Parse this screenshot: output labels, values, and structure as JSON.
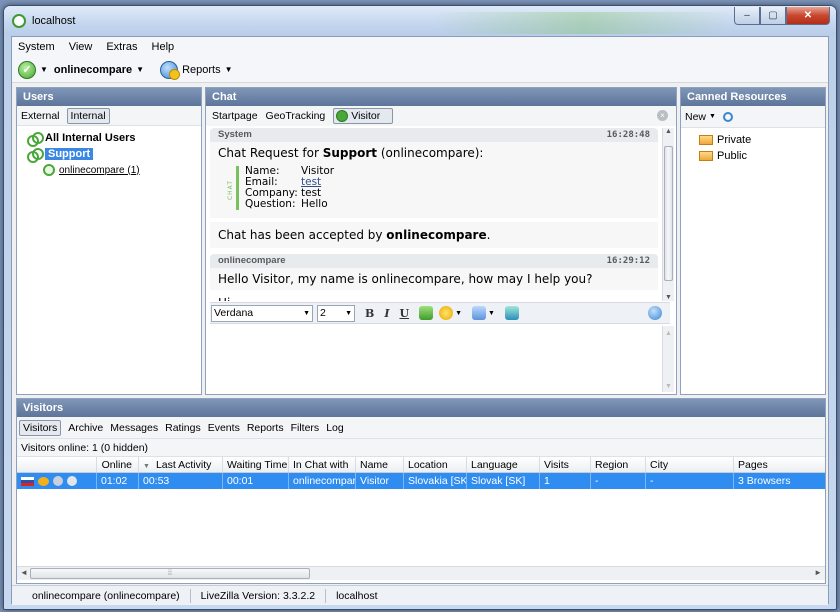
{
  "window": {
    "title": "localhost",
    "buttons": [
      "–",
      "▢",
      "✕"
    ]
  },
  "menu": {
    "items": [
      "System",
      "View",
      "Extras",
      "Help"
    ]
  },
  "toolbar": {
    "user_label": "onlinecompare",
    "reports_label": "Reports"
  },
  "users_panel": {
    "title": "Users",
    "tabs": [
      "External",
      "Internal"
    ],
    "selected_tab": "Internal",
    "tree": {
      "all": "All Internal Users",
      "group": "Support",
      "member": "onlinecompare (1)"
    }
  },
  "chat_panel": {
    "title": "Chat",
    "tabs": [
      "Startpage",
      "GeoTracking",
      "Visitor"
    ],
    "selected_tab": "Visitor",
    "messages": [
      {
        "sender": "System",
        "time": "16:28:48",
        "line1_prefix": "Chat Request for ",
        "line1_bold": "Support",
        "line1_suffix": " (onlinecompare):",
        "form_tag": "CHAT",
        "fields": [
          {
            "label": "Name:",
            "value": "Visitor"
          },
          {
            "label": "Email:",
            "value": "test"
          },
          {
            "label": "Company:",
            "value": "test"
          },
          {
            "label": "Question:",
            "value": "Hello"
          }
        ],
        "accepted_prefix": "Chat has been accepted by ",
        "accepted_bold": "onlinecompare",
        "accepted_suffix": "."
      },
      {
        "sender": "onlinecompare",
        "time": "16:29:12",
        "text": "Hello Visitor, my name is onlinecompare, how may I help you?",
        "reply": "Hi"
      }
    ],
    "format": {
      "font": "Verdana",
      "size": "2",
      "bold": "B",
      "italic": "I",
      "underline": "U"
    }
  },
  "canned_panel": {
    "title": "Canned Resources",
    "new_label": "New",
    "folders": [
      "Private",
      "Public"
    ]
  },
  "visitors_panel": {
    "title": "Visitors",
    "tabs": [
      "Visitors",
      "Archive",
      "Messages",
      "Ratings",
      "Events",
      "Reports",
      "Filters",
      "Log"
    ],
    "selected_tab": "Visitors",
    "online_info": "Visitors online: 1 (0 hidden)",
    "columns": [
      "Online",
      "Last Activity",
      "Waiting Time",
      "In Chat with",
      "Name",
      "Location",
      "Language",
      "Visits",
      "Region",
      "City",
      "Pages"
    ],
    "rows": [
      [
        "01:02",
        "00:53",
        "00:01",
        "onlinecompare",
        "Visitor",
        "Slovakia [SK]",
        "Slovak [SK]",
        "1",
        "-",
        "-",
        "3 Browsers"
      ]
    ]
  },
  "statusbar": {
    "user": "onlinecompare (onlinecompare)",
    "version": "LiveZilla Version: 3.3.2.2",
    "server": "localhost"
  },
  "colors": {
    "accent_green": "#4aa83a",
    "selection_blue": "#2f8cf0",
    "panel_header": "#5d7599"
  }
}
